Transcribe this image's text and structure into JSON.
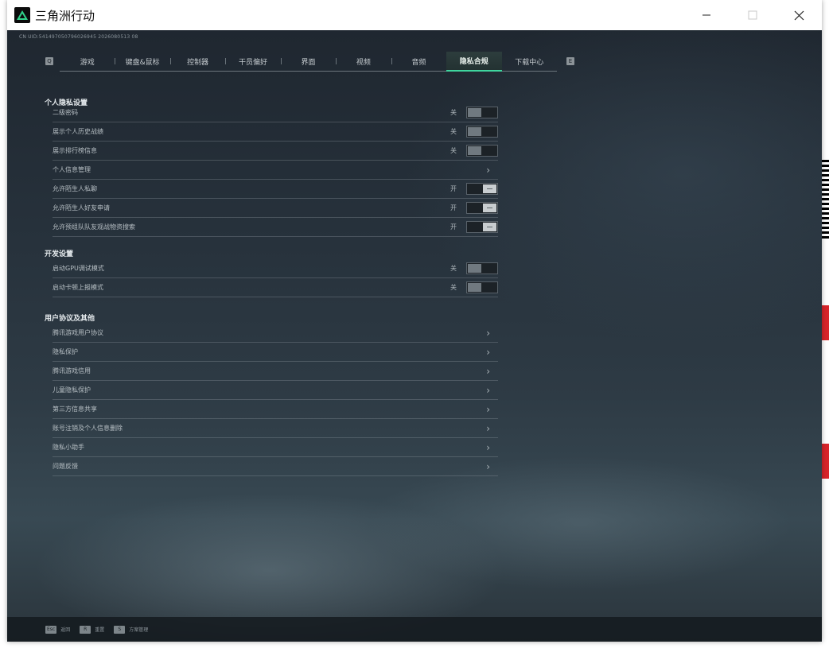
{
  "window": {
    "title": "三角洲行动",
    "minimize_icon": "minimize-icon",
    "maximize_icon": "maximize-icon",
    "close_icon": "close-icon"
  },
  "build_id": "CN UID:541497050796026945 2026080513 08",
  "tabs": {
    "left_key": "Q",
    "right_key": "E",
    "items": [
      {
        "label": "游戏"
      },
      {
        "label": "键盘&鼠标"
      },
      {
        "label": "控制器"
      },
      {
        "label": "干员偏好"
      },
      {
        "label": "界面"
      },
      {
        "label": "视频"
      },
      {
        "label": "音频"
      },
      {
        "label": "隐私合规",
        "active": true
      },
      {
        "label": "下载中心"
      }
    ]
  },
  "sections": {
    "personal_privacy": {
      "title": "个人隐私设置",
      "rows": [
        {
          "label": "二级密码",
          "state": "关",
          "type": "toggle",
          "on": false
        },
        {
          "label": "展示个人历史战绩",
          "state": "关",
          "type": "toggle",
          "on": false
        },
        {
          "label": "展示排行榜信息",
          "state": "关",
          "type": "toggle",
          "on": false
        },
        {
          "label": "个人信息管理",
          "type": "link"
        },
        {
          "label": "允许陌生人私聊",
          "state": "开",
          "type": "toggle",
          "on": true
        },
        {
          "label": "允许陌生人好友申请",
          "state": "开",
          "type": "toggle",
          "on": true
        },
        {
          "label": "允许预组队队友观战物资搜索",
          "state": "开",
          "type": "toggle",
          "on": true
        }
      ]
    },
    "developer": {
      "title": "开发设置",
      "rows": [
        {
          "label": "启动GPU调试模式",
          "state": "关",
          "type": "toggle",
          "on": false
        },
        {
          "label": "启动卡顿上报模式",
          "state": "关",
          "type": "toggle",
          "on": false
        }
      ]
    },
    "agreements": {
      "title": "用户协议及其他",
      "rows": [
        {
          "label": "腾讯游戏用户协议",
          "type": "link"
        },
        {
          "label": "隐私保护",
          "type": "link"
        },
        {
          "label": "腾讯游戏信用",
          "type": "link"
        },
        {
          "label": "儿童隐私保护",
          "type": "link"
        },
        {
          "label": "第三方信息共享",
          "type": "link"
        },
        {
          "label": "账号注销及个人信息删除",
          "type": "link"
        },
        {
          "label": "隐私小助手",
          "type": "link"
        },
        {
          "label": "问题反馈",
          "type": "link"
        }
      ]
    }
  },
  "bottom_hints": [
    {
      "key": "Esc",
      "label": "返回"
    },
    {
      "key": "R",
      "label": "重置"
    },
    {
      "key": "S",
      "label": "方案管理"
    }
  ],
  "colors": {
    "accent": "#3fd59e",
    "desktop_red": "#d8242a"
  }
}
